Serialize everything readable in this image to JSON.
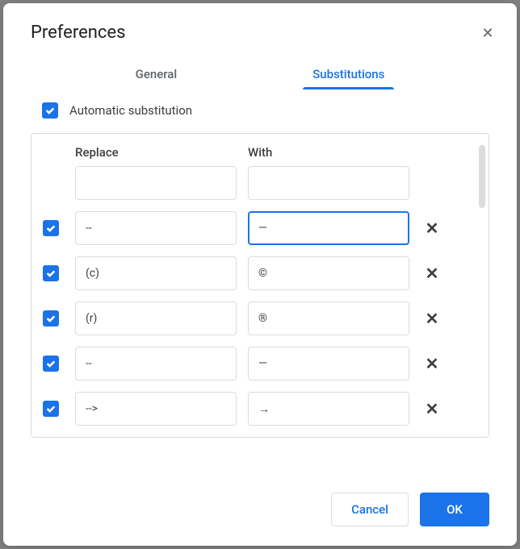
{
  "title": "Preferences",
  "tabs": {
    "general": "General",
    "substitutions": "Substitutions"
  },
  "auto_sub_label": "Automatic substitution",
  "headers": {
    "replace": "Replace",
    "with": "With"
  },
  "rows": [
    {
      "checked": false,
      "replace": "",
      "with": "",
      "deletable": false,
      "focused": false
    },
    {
      "checked": true,
      "replace": "--",
      "with": "—",
      "deletable": true,
      "focused": true
    },
    {
      "checked": true,
      "replace": "(c)",
      "with": "©",
      "deletable": true,
      "focused": false
    },
    {
      "checked": true,
      "replace": "(r)",
      "with": "®",
      "deletable": true,
      "focused": false
    },
    {
      "checked": true,
      "replace": "--",
      "with": "—",
      "deletable": true,
      "focused": false
    },
    {
      "checked": true,
      "replace": "-->",
      "with": "→",
      "deletable": true,
      "focused": false
    }
  ],
  "buttons": {
    "cancel": "Cancel",
    "ok": "OK"
  }
}
